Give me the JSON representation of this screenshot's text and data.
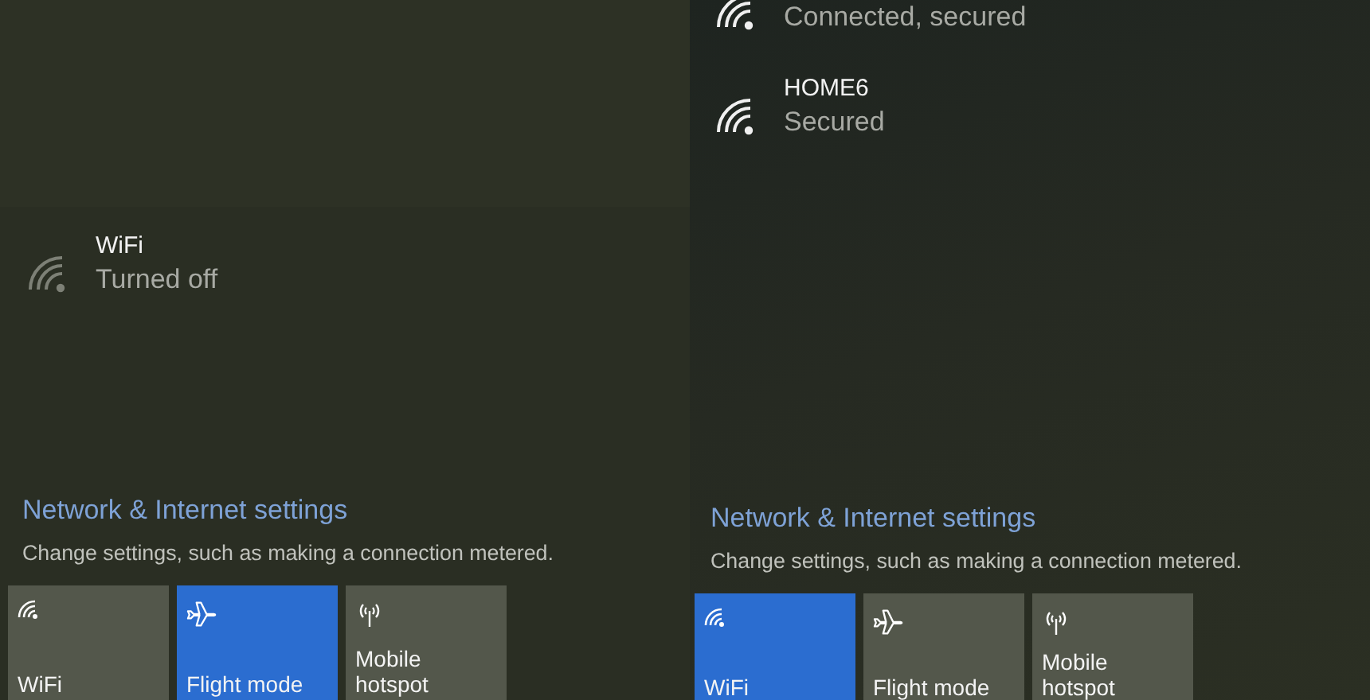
{
  "panels": [
    {
      "networks": [
        {
          "name": "WiFi",
          "status": "Turned off",
          "enabled": false
        }
      ],
      "settings_link": "Network & Internet settings",
      "settings_description": "Change settings, such as making a connection metered.",
      "tiles": [
        {
          "kind": "wifi",
          "label": "WiFi",
          "selected": false
        },
        {
          "kind": "airplane",
          "label": "Flight mode",
          "selected": true
        },
        {
          "kind": "hotspot",
          "label": "Mobile hotspot",
          "selected": false
        }
      ]
    },
    {
      "networks": [
        {
          "status": "Connected, secured",
          "enabled": true
        },
        {
          "name": "HOME6",
          "status": "Secured",
          "enabled": true
        }
      ],
      "settings_link": "Network & Internet settings",
      "settings_description": "Change settings, such as making a connection metered.",
      "tiles": [
        {
          "kind": "wifi",
          "label": "WiFi",
          "selected": true
        },
        {
          "kind": "airplane",
          "label": "Flight mode",
          "selected": false
        },
        {
          "kind": "hotspot",
          "label": "Mobile hotspot",
          "selected": false
        }
      ]
    }
  ]
}
